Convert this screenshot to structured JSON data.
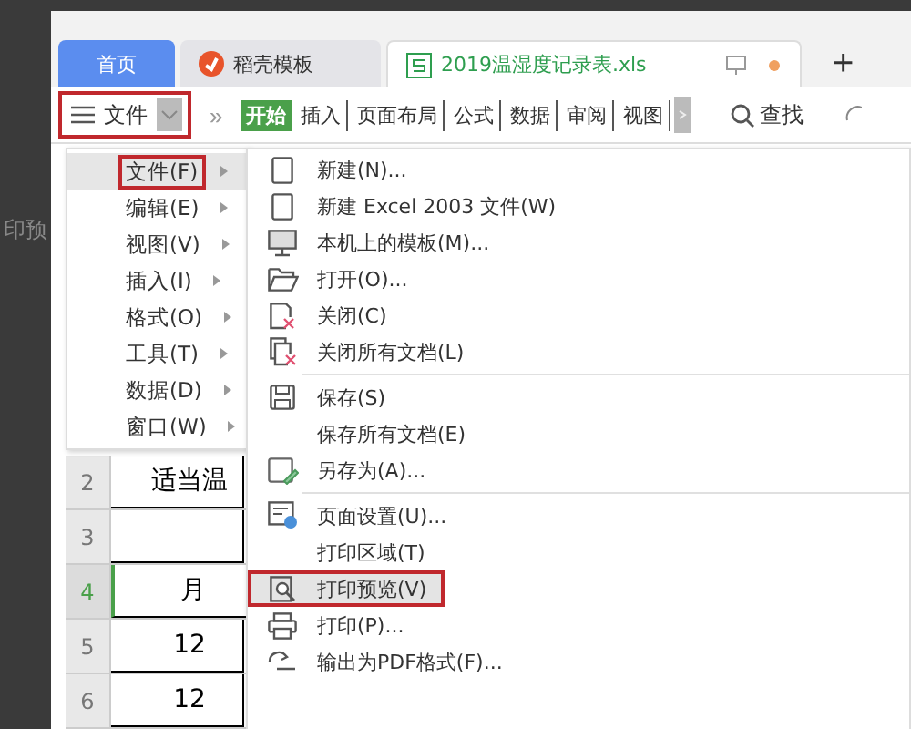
{
  "background_text": "印预",
  "tabs": [
    {
      "label": "首页",
      "kind": "home",
      "selected": false
    },
    {
      "label": "稻壳模板",
      "kind": "docer",
      "selected": false
    },
    {
      "label": "2019温湿度记录表.xls",
      "kind": "sheet",
      "selected": true
    }
  ],
  "new_tab": "+",
  "toolbar": {
    "file_button": {
      "label": "文件",
      "outlined": true
    },
    "more": "»",
    "ribbon_tabs": [
      {
        "label": "开始",
        "selected": true
      },
      {
        "label": "插入",
        "selected": false
      },
      {
        "label": "页面布局",
        "selected": false
      },
      {
        "label": "公式",
        "selected": false
      },
      {
        "label": "数据",
        "selected": false
      },
      {
        "label": "审阅",
        "selected": false
      },
      {
        "label": "视图",
        "selected": false
      }
    ],
    "search": "查找"
  },
  "menu": [
    {
      "label": "文件(F)",
      "selected": true
    },
    {
      "label": "编辑(E)",
      "selected": false
    },
    {
      "label": "视图(V)",
      "selected": false
    },
    {
      "label": "插入(I)",
      "selected": false
    },
    {
      "label": "格式(O)",
      "selected": false
    },
    {
      "label": "工具(T)",
      "selected": false
    },
    {
      "label": "数据(D)",
      "selected": false
    },
    {
      "label": "窗口(W)",
      "selected": false
    }
  ],
  "submenu": [
    {
      "label": "新建(N)...",
      "kind": "page",
      "divider_before": false,
      "selected": false
    },
    {
      "label": "新建 Excel 2003 文件(W)",
      "kind": "page",
      "divider_before": false,
      "selected": false
    },
    {
      "label": "本机上的模板(M)...",
      "kind": "monitor",
      "divider_before": false,
      "selected": false
    },
    {
      "label": "打开(O)...",
      "kind": "folder",
      "divider_before": false,
      "selected": false
    },
    {
      "label": "关闭(C)",
      "kind": "close",
      "divider_before": false,
      "selected": false
    },
    {
      "label": "关闭所有文档(L)",
      "kind": "closeall",
      "divider_before": false,
      "selected": false
    },
    {
      "label": "保存(S)",
      "kind": "save",
      "divider_before": true,
      "selected": false
    },
    {
      "label": "保存所有文档(E)",
      "kind": "none",
      "divider_before": false,
      "selected": false
    },
    {
      "label": "另存为(A)...",
      "kind": "saveas",
      "divider_before": false,
      "selected": false
    },
    {
      "label": "页面设置(U)...",
      "kind": "setup",
      "divider_before": true,
      "selected": false
    },
    {
      "label": "打印区域(T)",
      "kind": "none",
      "divider_before": false,
      "selected": false
    },
    {
      "label": "打印预览(V)",
      "kind": "preview",
      "divider_before": false,
      "selected": true
    },
    {
      "label": "打印(P)...",
      "kind": "print",
      "divider_before": false,
      "selected": false
    },
    {
      "label": "输出为PDF格式(F)...",
      "kind": "pdf",
      "divider_before": false,
      "selected": false
    }
  ],
  "sheet_rows": [
    {
      "number": "2",
      "cell": "适当温",
      "selected": false
    },
    {
      "number": "3",
      "cell": "",
      "selected": false
    },
    {
      "number": "4",
      "cell": "月",
      "selected": true
    },
    {
      "number": "5",
      "cell": "12",
      "selected": false
    },
    {
      "number": "6",
      "cell": "12",
      "selected": false
    }
  ]
}
